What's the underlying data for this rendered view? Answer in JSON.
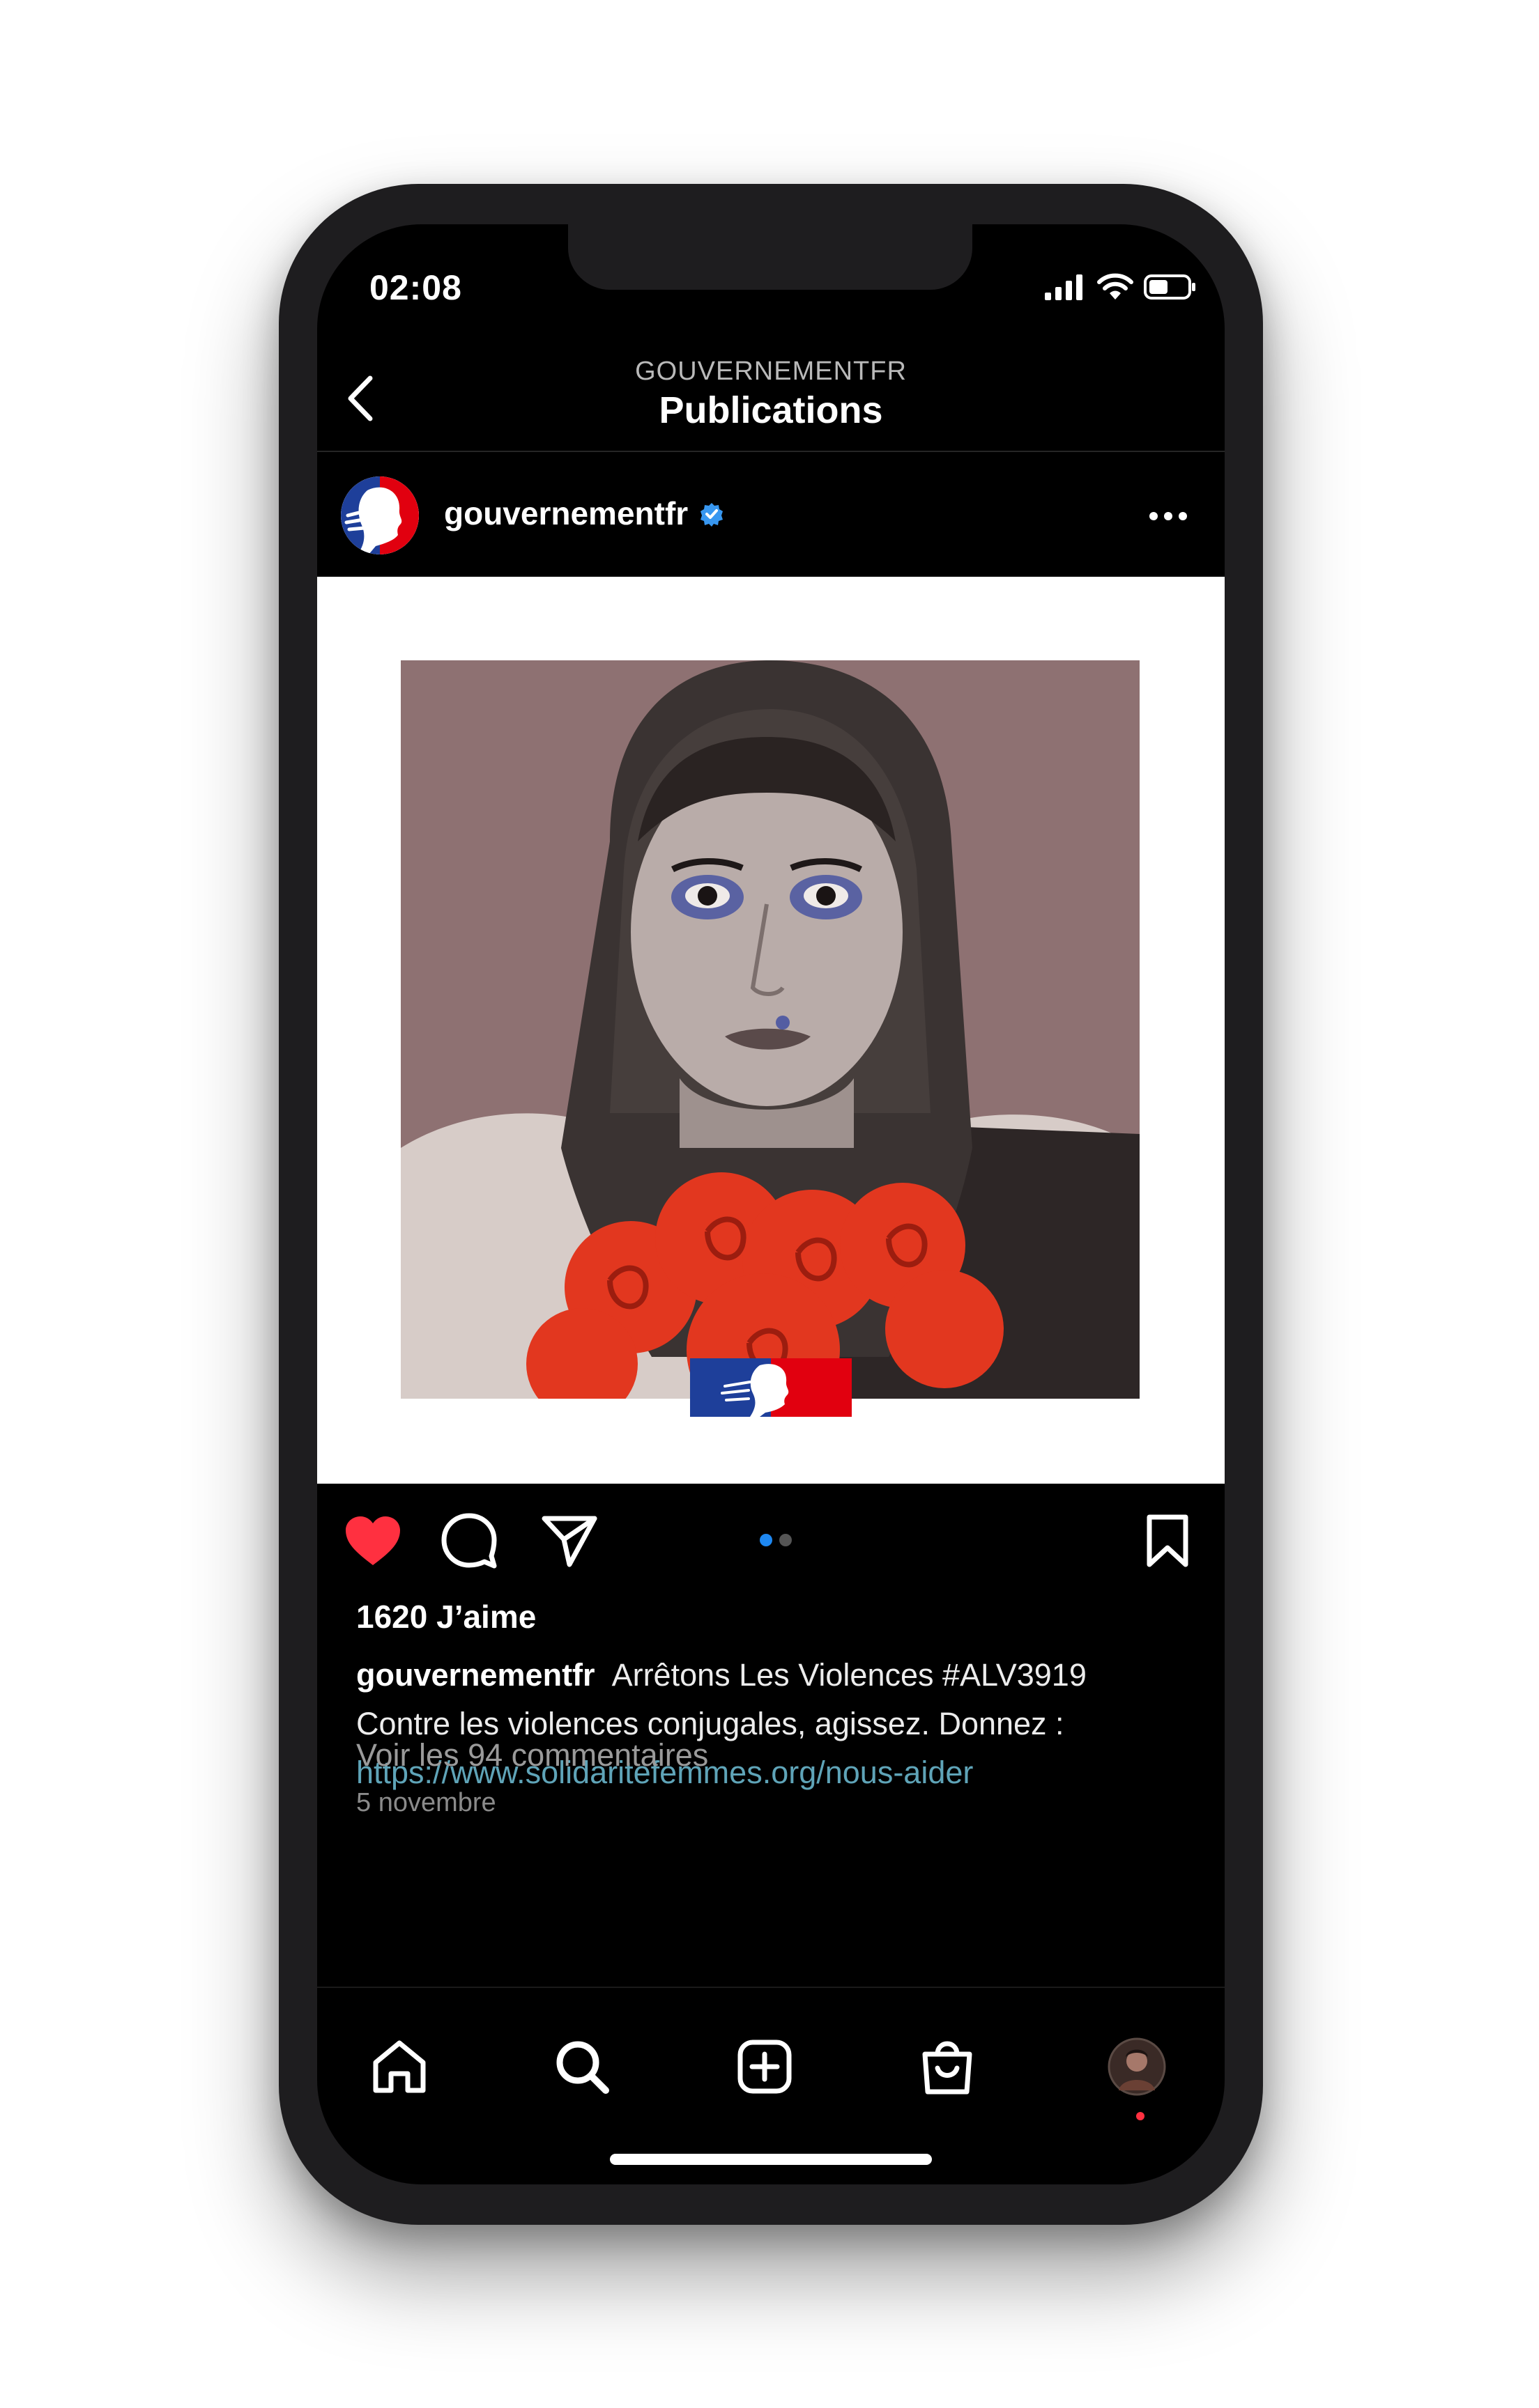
{
  "status_bar": {
    "time": "02:08"
  },
  "header": {
    "subtitle": "GOUVERNEMENTFR",
    "title": "Publications"
  },
  "post": {
    "username": "gouvernementfr",
    "likes": "1620 J’aime",
    "caption_user": "gouvernementfr",
    "caption_line1": "Arrêtons Les Violences #ALV3919",
    "caption_line2": "Contre les violences conjugales, agissez. Donnez :",
    "caption_link": "https://www.solidaritefemmes.org/nous-aider",
    "comments_link": "Voir les 94 commentaires",
    "date": "5 novembre",
    "carousel": {
      "count": 2,
      "active": 1
    }
  },
  "colors": {
    "background": "#000000",
    "like_heart": "#ff3040",
    "link": "#5fa4b8",
    "verified": "#3897f0",
    "photo_bg": "#8e7172",
    "roses": "#e2371f"
  },
  "icons": [
    "back-chevron-icon",
    "verified-badge-icon",
    "more-options-icon",
    "heart-icon",
    "comment-icon",
    "share-icon",
    "bookmark-icon",
    "home-icon",
    "search-icon",
    "create-post-icon",
    "shop-icon",
    "profile-avatar-icon"
  ]
}
